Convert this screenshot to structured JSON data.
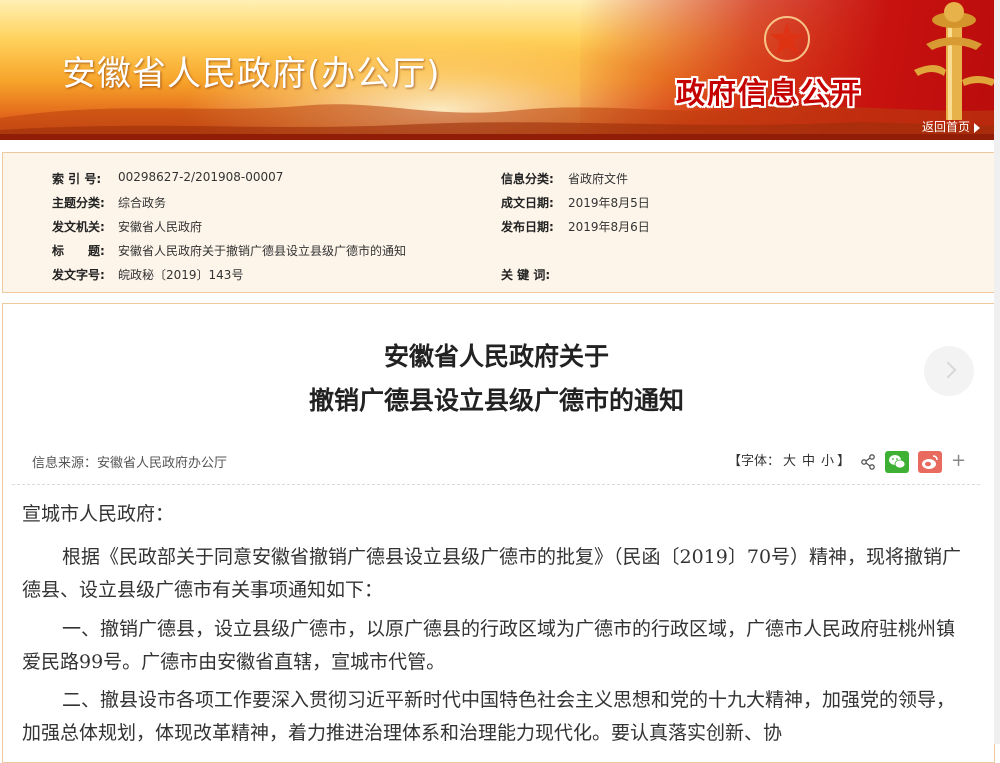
{
  "header": {
    "site_title": "安徽省人民政府(办公厅)",
    "gov_info_open": "政府信息公开",
    "return_home": "返回首页"
  },
  "meta": {
    "left": [
      {
        "label": "索 引 号:",
        "value": "00298627-2/201908-00007"
      },
      {
        "label": "主题分类:",
        "value": "综合政务"
      },
      {
        "label": "发文机关:",
        "value": "安徽省人民政府"
      },
      {
        "label": "标　　题:",
        "value": "安徽省人民政府关于撤销广德县设立县级广德市的通知"
      },
      {
        "label": "发文字号:",
        "value": "皖政秘〔2019〕143号"
      }
    ],
    "right": [
      {
        "label": "信息分类:",
        "value": "省政府文件"
      },
      {
        "label": "成文日期:",
        "value": "2019年8月5日"
      },
      {
        "label": "发布日期:",
        "value": "2019年8月6日"
      },
      {
        "label": "关 键 词:",
        "value": ""
      }
    ]
  },
  "doc": {
    "title_line1": "安徽省人民政府关于",
    "title_line2": "撤销广德县设立县级广德市的通知",
    "source": "信息来源：安徽省人民政府办公厅",
    "font_label_open": "【字体：",
    "font_large": "大",
    "font_medium": "中",
    "font_small": "小",
    "font_label_close": "】",
    "paragraphs": [
      "宣城市人民政府：",
      "根据《民政部关于同意安徽省撤销广德县设立县级广德市的批复》（民函〔2019〕70号）精神，现将撤销广德县、设立县级广德市有关事项通知如下：",
      "一、撤销广德县，设立县级广德市，以原广德县的行政区域为广德市的行政区域，广德市人民政府驻桃州镇爱民路99号。广德市由安徽省直辖，宣城市代管。",
      "二、撤县设市各项工作要深入贯彻习近平新时代中国特色社会主义思想和党的十九大精神，加强党的领导，加强总体规划，体现改革精神，着力推进治理体系和治理能力现代化。要认真落实创新、协"
    ]
  },
  "colors": {
    "banner_orange": "#f7a42a",
    "banner_red": "#c8120f",
    "meta_bg": "#fdf5ea",
    "meta_border": "#f0c8a0",
    "wechat_green": "#3eb135",
    "weibo_red": "#e96a5e"
  },
  "icons": [
    "emblem-star-icon",
    "huabiao-pillar-icon",
    "share-icon",
    "wechat-icon",
    "weibo-icon",
    "plus-icon",
    "chevron-right-icon"
  ]
}
